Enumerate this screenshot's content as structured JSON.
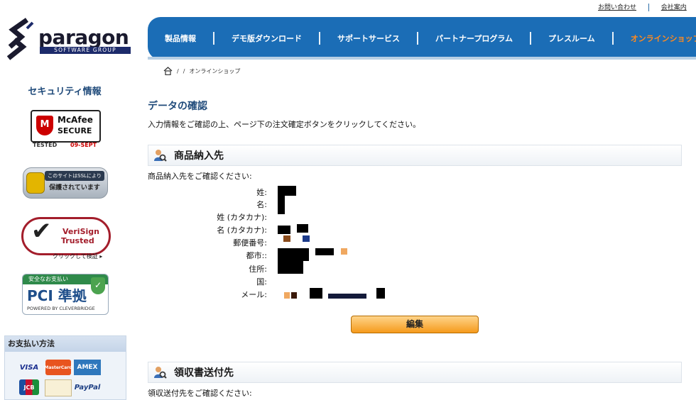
{
  "top_links": [
    "お問い合わせ",
    "会社案内"
  ],
  "logo": {
    "name": "paragon",
    "subtitle": "SOFTWARE GROUP"
  },
  "nav": {
    "items": [
      "製品情報",
      "デモ版ダウンロード",
      "サポートサービス",
      "パートナープログラム",
      "プレスルーム",
      "オンラインショップ"
    ],
    "active_index": 5
  },
  "breadcrumb": {
    "sep1": "/",
    "sep2": "/",
    "current": "オンラインショップ"
  },
  "sidebar": {
    "security_title": "セキュリティ情報",
    "mcafee": {
      "brand": "McAfee",
      "product": "SECURE",
      "tested": "TESTED",
      "date": "09-SEPT"
    },
    "ssl": {
      "line1": "このサイトはSSLにより",
      "line2": "保護されています"
    },
    "verisign": {
      "line1": "VeriSign",
      "line2": "Trusted",
      "sub": "クリックして検証 ▸"
    },
    "pci": {
      "top": "安全なお支払い",
      "main": "PCI 準拠",
      "powered": "POWERED BY CLEVERBRIDGE"
    },
    "payment_title": "お支払い方法",
    "cards": [
      "VISA",
      "MasterCard",
      "AMEX",
      "JCB",
      "",
      "PayPal"
    ]
  },
  "main": {
    "title": "データの確認",
    "intro": "入力情報をご確認の上、ページ下の注文確定ボタンをクリックしてください。",
    "shipping": {
      "heading": "商品納入先",
      "lead": "商品納入先をご確認ください:",
      "labels": [
        "姓:",
        "名:",
        "姓 (カタカナ):",
        "名 (カタカナ):",
        "郵便番号:",
        "都市::",
        "住所:",
        "国:",
        "メール:"
      ]
    },
    "edit_button": "編集",
    "receipt": {
      "heading": "領収書送付先",
      "lead": "領収送付先をご確認ください:"
    }
  },
  "colors": {
    "nav_blue": "#1b6db6",
    "active_orange": "#ff8a1f",
    "title_blue": "#1f4a7a"
  }
}
